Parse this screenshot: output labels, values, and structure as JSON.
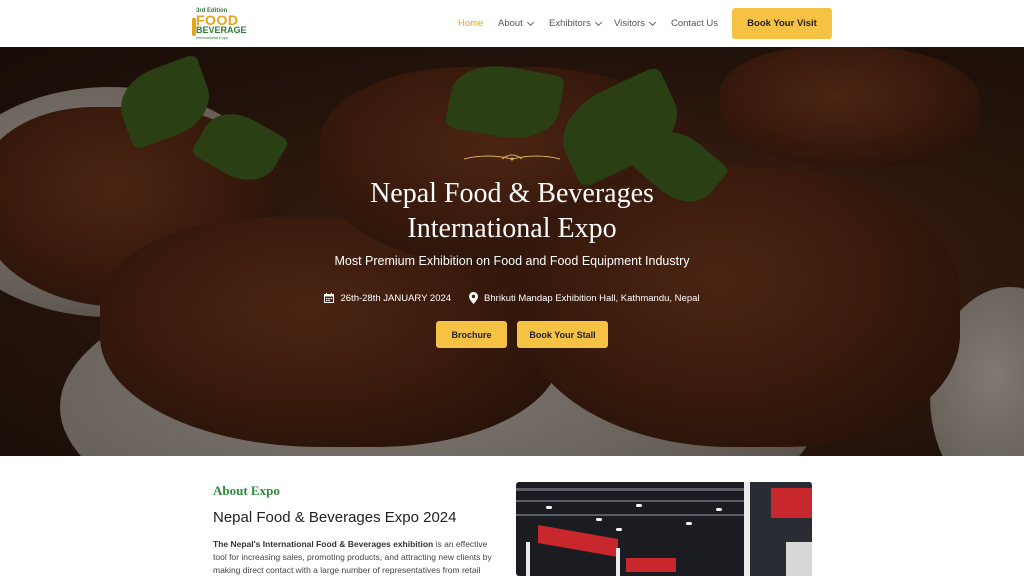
{
  "header": {
    "logo": {
      "edition": "3rd Edition",
      "line1": "FOOD",
      "line2": "BEVERAGE",
      "line3": "International Expo"
    },
    "nav": {
      "home": "Home",
      "about": "About",
      "exhibitors": "Exhibitors",
      "visitors": "Visitors",
      "contact": "Contact Us"
    },
    "cta": "Book Your Visit"
  },
  "hero": {
    "title_line1": "Nepal Food & Beverages",
    "title_line2": "International Expo",
    "subtitle": "Most Premium Exhibition on Food and Food Equipment Industry",
    "date": "26th-28th JANUARY 2024",
    "location": "Bhrikuti Mandap Exhibition Hall, Kathmandu, Nepal",
    "buttons": {
      "brochure": "Brochure",
      "book_stall": "Book Your Stall"
    }
  },
  "about": {
    "label": "About Expo",
    "title": "Nepal Food & Beverages Expo 2024",
    "text_bold": "The Nepal's International Food & Beverages exhibition",
    "text_rest": " is an effective tool for increasing sales, promoting products, and attracting new clients by making direct contact with a large number of representatives from retail chains and"
  },
  "colors": {
    "accent": "#f6c244",
    "active_nav": "#e8a317",
    "green": "#2e8b3a"
  }
}
